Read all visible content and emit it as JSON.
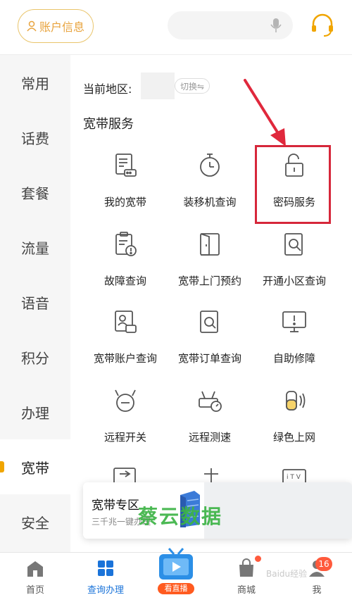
{
  "header": {
    "account_label": "账户信息",
    "search_placeholder": ""
  },
  "categories": [
    "常用",
    "话费",
    "套餐",
    "流量",
    "语音",
    "积分",
    "办理",
    "宽带",
    "安全"
  ],
  "active_category": "宽带",
  "region": {
    "label": "当前地区:",
    "value": "",
    "switch_label": "切换⇋"
  },
  "section": {
    "title": "宽带服务"
  },
  "services": [
    {
      "label": "我的宽带",
      "icon": "broadband-doc-icon"
    },
    {
      "label": "装移机查询",
      "icon": "stopwatch-icon"
    },
    {
      "label": "密码服务",
      "icon": "unlock-icon"
    },
    {
      "label": "故障查询",
      "icon": "fault-doc-icon"
    },
    {
      "label": "宽带上门预约",
      "icon": "door-icon"
    },
    {
      "label": "开通小区查询",
      "icon": "search-doc-icon"
    },
    {
      "label": "宽带账户查询",
      "icon": "account-doc-icon"
    },
    {
      "label": "宽带订单查询",
      "icon": "order-search-icon"
    },
    {
      "label": "自助修障",
      "icon": "monitor-alert-icon"
    },
    {
      "label": "远程开关",
      "icon": "remote-switch-icon"
    },
    {
      "label": "远程测速",
      "icon": "speed-test-icon"
    },
    {
      "label": "绿色上网",
      "icon": "green-net-icon"
    }
  ],
  "promo": {
    "title": "宽带专区",
    "subtitle": "三千兆一键办理"
  },
  "watermark": "蔡云数据",
  "bottom_nav": {
    "home": "首页",
    "query": "查询办理",
    "live": "看直播",
    "mall": "商城",
    "me": "我",
    "me_badge": "16"
  },
  "baidu_watermark": "Baidu经验"
}
